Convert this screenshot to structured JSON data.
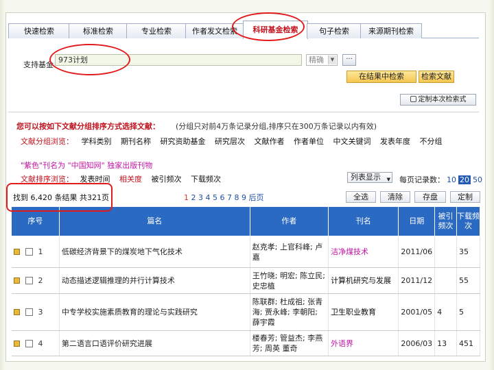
{
  "tabs": [
    "快速检索",
    "标准检索",
    "专业检索",
    "作者发文检索",
    "科研基金检索",
    "句子检索",
    "来源期刊检索"
  ],
  "active_tab": "科研基金检索",
  "search": {
    "label": "支持基金：",
    "value": "973计划",
    "match": "精确",
    "more": "···",
    "in_result_button": "在结果中检索",
    "search_button": "检索文献",
    "custom_button": "定制本次检索式"
  },
  "grouping": {
    "title": "您可以按如下文献分组排序方式选择文献：",
    "note": "(分组只对前4万条记录分组,排序只在300万条记录以内有效)",
    "label": "文献分组浏览：",
    "items": [
      "学科类别",
      "期刊名称",
      "研究资助基金",
      "研究层次",
      "文献作者",
      "作者单位",
      "中文关键词",
      "发表年度",
      "不分组"
    ]
  },
  "purple_note": "\"紫色\"刊名为 \"中国知网\" 独家出版刊物",
  "sorting": {
    "label": "文献排序浏览：",
    "items": [
      "发表时间",
      "相关度",
      "被引频次",
      "下载频次"
    ],
    "selected": "相关度"
  },
  "display": {
    "mode": "列表显示",
    "per_page_label": "每页记录数：",
    "per_page_options": [
      "10",
      "20",
      "50"
    ],
    "per_page_current": "20"
  },
  "summary": "找到 6,420 条结果 共321页",
  "pager": {
    "current": "1",
    "pages": "2 3 4 5 6 7 8 9",
    "next": "后页"
  },
  "toolbar": {
    "select_all": "全选",
    "clear": "清除",
    "save": "存盘",
    "custom": "定制"
  },
  "table": {
    "headers": {
      "no": "序号",
      "title": "篇名",
      "author": "作者",
      "source": "刊名",
      "date": "日期",
      "cited": "被引频次",
      "downloads": "下载频次"
    },
    "rows": [
      {
        "no": "1",
        "title": "低碳经济背景下的煤炭地下气化技术",
        "author": "赵克孝; 上官科峰; 卢嘉",
        "source": "洁净煤技术",
        "source_exclusive": true,
        "date": "2011/06",
        "cited": "",
        "downloads": "35"
      },
      {
        "no": "2",
        "title": "动态描述逻辑推理的并行计算技术",
        "author": "王竹晓; 明宏; 陈立民; 史忠植",
        "source": "计算机研究与发展",
        "source_exclusive": false,
        "date": "2011/12",
        "cited": "",
        "downloads": "55"
      },
      {
        "no": "3",
        "title": "中专学校实施素质教育的理论与实践研究",
        "author": "陈联群; 杜成祖; 张青海; 贾永峰; 李朝阳; 薛宇霞",
        "source": "卫生职业教育",
        "source_exclusive": false,
        "date": "2001/05",
        "cited": "4",
        "downloads": "5"
      },
      {
        "no": "4",
        "title": "第二语言口语评价研究进展",
        "author": "楼春芳; 管益杰; 李燕芳; 周英 董奇",
        "source": "外语界",
        "source_exclusive": true,
        "date": "2006/03",
        "cited": "13",
        "downloads": "451"
      }
    ]
  },
  "colors": {
    "accent_red": "#c2121d",
    "header_blue": "#2a6ac2",
    "exclusive_purple": "#c215a4",
    "highlight": "#e11b1b"
  }
}
